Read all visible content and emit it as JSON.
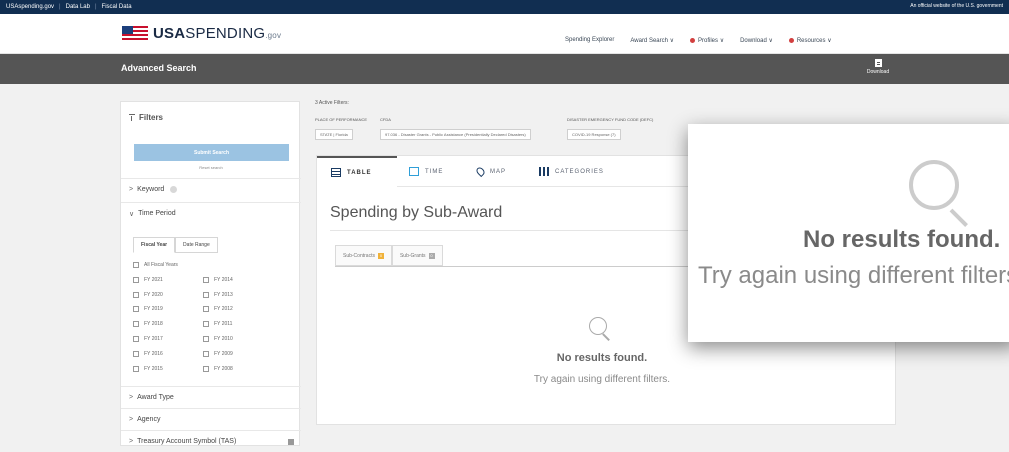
{
  "topbar": {
    "links": [
      "USAspending.gov",
      "Data Lab",
      "Fiscal Data"
    ],
    "official_text": "An official website of the U.S. government"
  },
  "header": {
    "logo_bold": "USA",
    "logo_light": "SPENDING",
    "logo_suffix": ".gov",
    "nav": [
      {
        "label": "Spending Explorer",
        "icon": "none"
      },
      {
        "label": "Award Search ∨",
        "icon": "none"
      },
      {
        "label": "Profiles ∨",
        "icon": "red-dot-icon"
      },
      {
        "label": "Download ∨",
        "icon": "none"
      },
      {
        "label": "Resources ∨",
        "icon": "red-dot-icon"
      }
    ]
  },
  "titlebar": {
    "title": "Advanced Search",
    "download_label": "Download"
  },
  "sidebar": {
    "title": "Filters",
    "submit_label": "Submit Search",
    "reset_label": "Reset search",
    "sections": {
      "keyword": "Keyword",
      "time_period": "Time Period",
      "award_type": "Award Type",
      "agency": "Agency",
      "tas": "Treasury Account Symbol (TAS)"
    },
    "time_tabs": [
      "Fiscal Year",
      "Date Range"
    ],
    "all_fiscal_years": "All Fiscal Years",
    "fiscal_years_left": [
      "FY 2021",
      "FY 2020",
      "FY 2019",
      "FY 2018",
      "FY 2017",
      "FY 2016",
      "FY 2015"
    ],
    "fiscal_years_right": [
      "FY 2014",
      "FY 2013",
      "FY 2012",
      "FY 2011",
      "FY 2010",
      "FY 2009",
      "FY 2008"
    ]
  },
  "active_filters": {
    "label": "3 Active Filters:",
    "groups": [
      {
        "label": "PLACE OF PERFORMANCE",
        "chip": "STATE | Florida"
      },
      {
        "label": "CFDA",
        "chip": "97.036 - Disaster Grants - Public Assistance (Presidentially Declared Disasters)"
      },
      {
        "label": "DISASTER EMERGENCY FUND CODE (DEFC)",
        "chip": "COVID-19 Response (7)"
      }
    ]
  },
  "main": {
    "tabs": [
      "TABLE",
      "TIME",
      "MAP",
      "CATEGORIES"
    ],
    "section_title": "Spending by Sub-Award",
    "sub_tabs": [
      {
        "label": "Sub-Contracts",
        "count": "0"
      },
      {
        "label": "Sub-Grants",
        "count": "0"
      }
    ],
    "empty_title": "No results found.",
    "empty_subtitle": "Try again using different filters."
  },
  "zoom": {
    "title": "No results found.",
    "subtitle": "Try again using different filters."
  },
  "colors": {
    "topbar": "#112e51",
    "titlebar": "#555555",
    "submit": "#9bc3e2",
    "accent_blue": "#2f9fd8",
    "badge_orange": "#f0b23a",
    "nav_dot": "#d23f3f"
  }
}
